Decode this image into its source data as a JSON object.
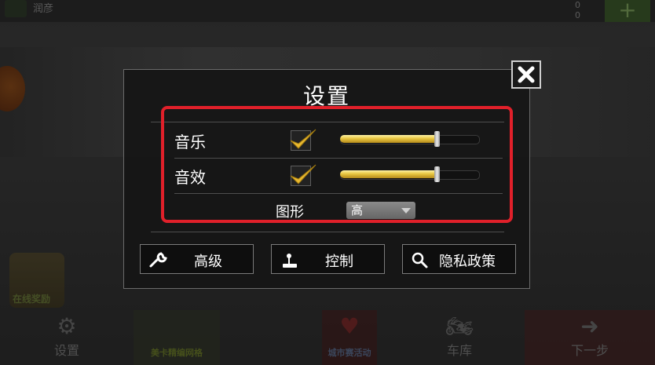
{
  "background": {
    "top_name": "润彦",
    "top_counters": [
      "0",
      "0"
    ],
    "top_plus": "+",
    "left_event_label": "在线奖励",
    "right_logo_text": "",
    "bottom_items": [
      {
        "label": "设置",
        "icon": "gear-icon"
      },
      {
        "label": "美卡精编网格",
        "icon": "money-icon"
      },
      {
        "label": "城市赛活动",
        "icon": "heart-icon"
      },
      {
        "label": "车库",
        "icon": "motorbike-icon"
      },
      {
        "label": "下一步",
        "icon": "arrow-right-icon"
      }
    ]
  },
  "dialog": {
    "title": "设置",
    "close_icon": "close-icon",
    "rows": [
      {
        "label": "音乐",
        "checked": true,
        "volume": 0.69
      },
      {
        "label": "音效",
        "checked": true,
        "volume": 0.69
      }
    ],
    "graphics": {
      "label": "图形",
      "selected": "高"
    },
    "buttons": [
      {
        "label": "高级",
        "icon": "wrench-icon"
      },
      {
        "label": "控制",
        "icon": "joystick-icon"
      },
      {
        "label": "隐私政策",
        "icon": "magnifier-icon"
      }
    ]
  },
  "colors": {
    "highlight": "#e0202a",
    "slider_fill": "#e8c640",
    "check": "#e8b830"
  }
}
